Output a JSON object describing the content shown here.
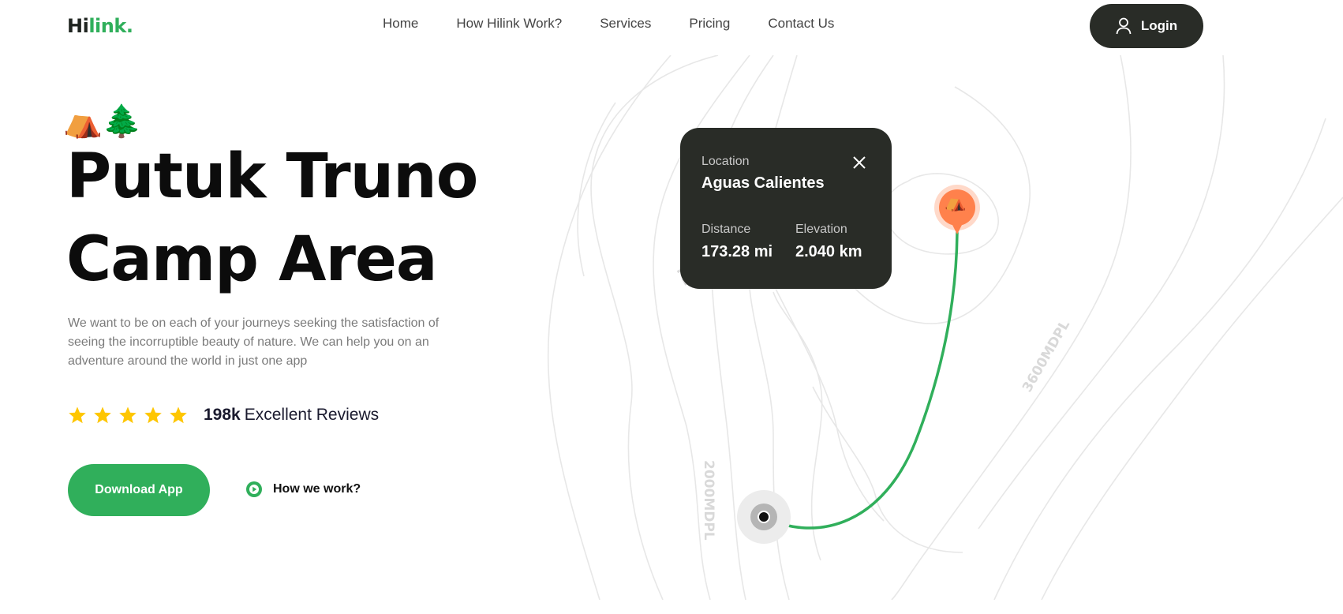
{
  "nav": {
    "logo_hi": "Hi",
    "logo_link": "link.",
    "links": [
      "Home",
      "How Hilink Work?",
      "Services",
      "Pricing",
      "Contact Us"
    ],
    "login_label": "Login"
  },
  "hero": {
    "title_line1": "Putuk Truno",
    "title_line2": "Camp Area",
    "description": "We want to be on each of your journeys seeking the satisfaction of seeing the incorruptible beauty of nature. We can help you on an adventure around the world in just one app",
    "rating": {
      "stars": 5,
      "count": "198k",
      "label": "Excellent Reviews"
    },
    "download_label": "Download App",
    "how_label": "How we work?"
  },
  "card": {
    "location_label": "Location",
    "location_value": "Aguas Calientes",
    "distance_label": "Distance",
    "distance_value": "173.28 mi",
    "elevation_label": "Elevation",
    "elevation_value": "2.040 km"
  },
  "map": {
    "contour_labels": [
      "3600MDPL",
      "2000MDPL",
      "PL"
    ]
  },
  "icons": {
    "camp": "⛺🌲",
    "pin_camp": "⛺",
    "user": "user-icon",
    "play": "play-icon",
    "close": "close-icon",
    "star": "star-icon"
  },
  "colors": {
    "accent_green": "#30af5b",
    "dark": "#292c27",
    "star": "#fec601",
    "pin": "#ff814c"
  }
}
